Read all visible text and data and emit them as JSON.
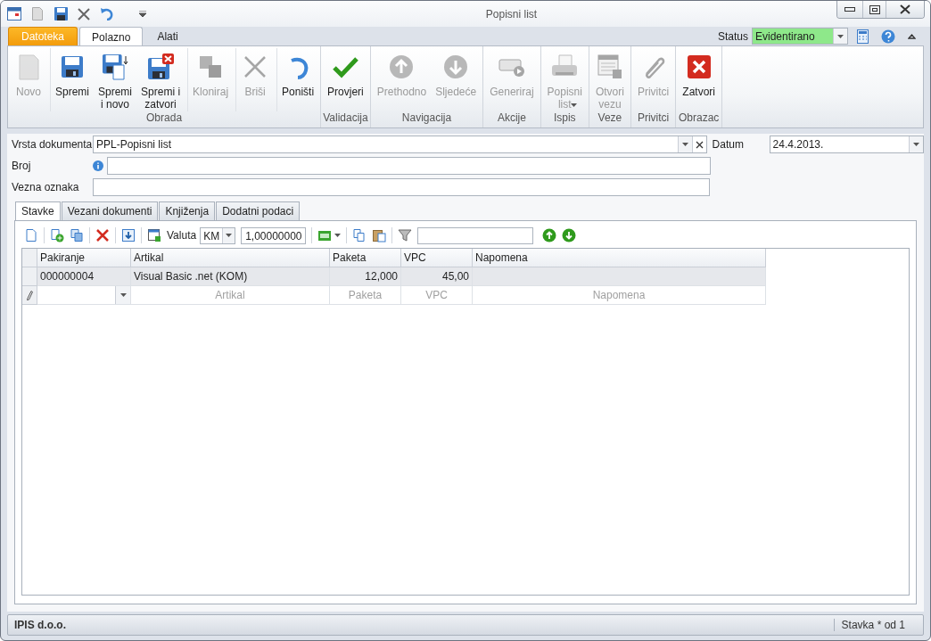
{
  "window": {
    "title": "Popisni list"
  },
  "ribbon_tabs": [
    {
      "label": "Datoteka",
      "kind": "file",
      "selected": false
    },
    {
      "label": "Polazno",
      "kind": "tab",
      "selected": true
    },
    {
      "label": "Alati",
      "kind": "tab",
      "selected": false
    }
  ],
  "status": {
    "label": "Status",
    "value": "Evidentirano"
  },
  "ribbon_groups": [
    {
      "label": "Obrada",
      "buttons": [
        {
          "label": "Novo",
          "kind": "new",
          "disabled": true
        },
        {
          "label": "Spremi",
          "kind": "save",
          "disabled": false,
          "separator": true
        },
        {
          "label": "Spremi\ni novo",
          "kind": "save-new",
          "disabled": false
        },
        {
          "label": "Spremi i\nzatvori",
          "kind": "save-close",
          "disabled": false
        },
        {
          "label": "Kloniraj",
          "kind": "clone",
          "disabled": true,
          "separator": true
        },
        {
          "label": "Briši",
          "kind": "delete",
          "disabled": true,
          "separator": true
        },
        {
          "label": "Poništi",
          "kind": "undo",
          "disabled": false,
          "separator": true
        }
      ]
    },
    {
      "label": "Validacija",
      "buttons": [
        {
          "label": "Provjeri",
          "kind": "check",
          "disabled": false
        }
      ]
    },
    {
      "label": "Navigacija",
      "buttons": [
        {
          "label": "Prethodno",
          "kind": "up",
          "disabled": true
        },
        {
          "label": "Sljedeće",
          "kind": "down",
          "disabled": true
        }
      ]
    },
    {
      "label": "Akcije",
      "buttons": [
        {
          "label": "Generiraj",
          "kind": "generate",
          "disabled": true
        }
      ]
    },
    {
      "label": "Ispis",
      "buttons": [
        {
          "label": "Popisni\nlist",
          "kind": "print",
          "disabled": true,
          "dropdown": true
        }
      ]
    },
    {
      "label": "Veze",
      "buttons": [
        {
          "label": "Otvori\nvezu",
          "kind": "link",
          "disabled": true
        }
      ]
    },
    {
      "label": "Privitci",
      "buttons": [
        {
          "label": "Privitci",
          "kind": "attach",
          "disabled": true
        }
      ]
    },
    {
      "label": "Obrazac",
      "buttons": [
        {
          "label": "Zatvori",
          "kind": "close",
          "disabled": false
        }
      ]
    }
  ],
  "form": {
    "document_type": {
      "label": "Vrsta dokumenta",
      "value": "PPL-Popisni list"
    },
    "date": {
      "label": "Datum",
      "value": "24.4.2013."
    },
    "number": {
      "label": "Broj"
    },
    "reference": {
      "label": "Vezna oznaka"
    }
  },
  "tabs": [
    {
      "label": "Stavke",
      "selected": true
    },
    {
      "label": "Vezani dokumenti",
      "selected": false
    },
    {
      "label": "Knjiženja",
      "selected": false
    },
    {
      "label": "Dodatni podaci",
      "selected": false
    }
  ],
  "toolbar": {
    "currency_label": "Valuta",
    "currency": "KM",
    "rate": "1,00000000"
  },
  "grid": {
    "columns": [
      {
        "label": "Pakiranje",
        "numeric": false
      },
      {
        "label": "Artikal",
        "numeric": false
      },
      {
        "label": "Paketa",
        "numeric": true
      },
      {
        "label": "VPC",
        "numeric": true
      },
      {
        "label": "Napomena"
      }
    ],
    "rows": [
      {
        "cells": [
          "000000004",
          "Visual Basic .net (KOM)",
          "12,000",
          "45,00"
        ]
      }
    ],
    "new_row": {
      "placeholders": [
        "Artikal",
        "Paketa",
        "VPC",
        "Napomena"
      ]
    }
  },
  "status_bar": {
    "company": "IPIS d.o.o.",
    "position": "Stavka * od 1"
  }
}
